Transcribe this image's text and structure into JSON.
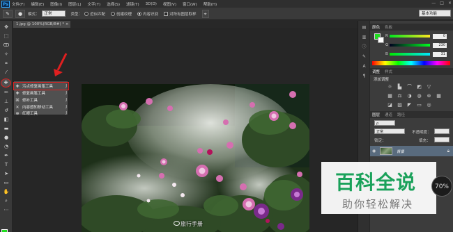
{
  "app": {
    "logo": "Ps"
  },
  "menubar": {
    "items": [
      "文件(F)",
      "编辑(E)",
      "图像(I)",
      "图层(L)",
      "文字(Y)",
      "选择(S)",
      "滤镜(T)",
      "3D(D)",
      "视图(V)",
      "窗口(W)",
      "帮助(H)"
    ],
    "window_controls": [
      "—",
      "□",
      "×"
    ]
  },
  "options": {
    "mode_label": "模式：",
    "mode_value": "正常",
    "type_label": "类型：",
    "radio_proximity": "近似匹配",
    "radio_texture": "创建纹理",
    "radio_content_aware": "内容识别",
    "sample_all_layers": "对所有图层取样",
    "workspace": "基本功能"
  },
  "document": {
    "tab_label": "1.jpg @ 100%(RGB/8#) *  ×",
    "watermark": "旅行手册"
  },
  "flyout": {
    "items": [
      {
        "icon": "spot-healing-brush-icon",
        "label": "污点修复画笔工具",
        "key": "J"
      },
      {
        "icon": "healing-brush-icon",
        "label": "修复画笔工具",
        "key": "J"
      },
      {
        "icon": "patch-icon",
        "label": "修补工具",
        "key": "J"
      },
      {
        "icon": "content-aware-move-icon",
        "label": "内容感知移动工具",
        "key": "J"
      },
      {
        "icon": "red-eye-icon",
        "label": "红眼工具",
        "key": "J"
      }
    ]
  },
  "color_panel": {
    "tabs": [
      "颜色",
      "色板"
    ],
    "fg_color": "#22dd22",
    "bg_color": "#ffffff",
    "sliders": [
      {
        "label": "R",
        "value": "0"
      },
      {
        "label": "G",
        "value": "230"
      },
      {
        "label": "B",
        "value": "31"
      }
    ]
  },
  "adjustments_panel": {
    "tabs": [
      "调整",
      "样式"
    ],
    "title": "添加调整"
  },
  "layers_panel": {
    "tabs": [
      "图层",
      "通道",
      "路径"
    ],
    "blend_mode": "正常",
    "opacity_label": "不透明度：",
    "lock_label": "锁定：",
    "fill_label": "填充：",
    "layer_name": "背景"
  },
  "overlay": {
    "title": "百科全说",
    "subtitle": "助你轻松解决",
    "zoom": "70%"
  }
}
